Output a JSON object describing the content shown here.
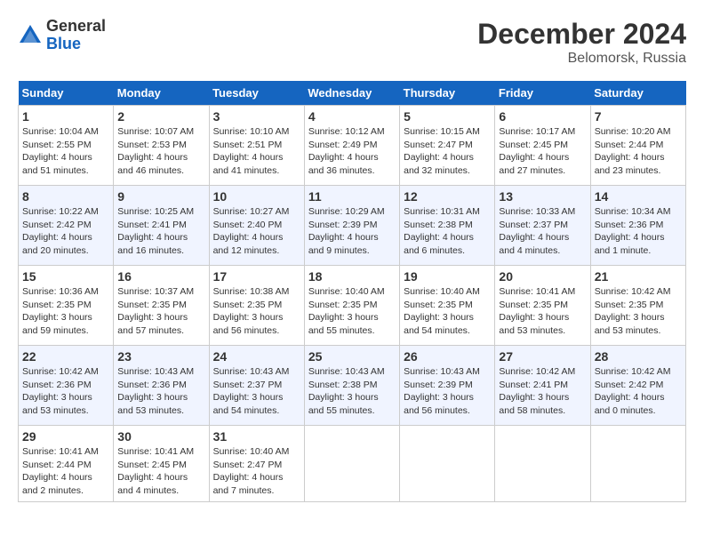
{
  "header": {
    "logo_general": "General",
    "logo_blue": "Blue",
    "month_title": "December 2024",
    "location": "Belomorsk, Russia"
  },
  "days_of_week": [
    "Sunday",
    "Monday",
    "Tuesday",
    "Wednesday",
    "Thursday",
    "Friday",
    "Saturday"
  ],
  "weeks": [
    [
      {
        "day": "1",
        "sunrise": "Sunrise: 10:04 AM",
        "sunset": "Sunset: 2:55 PM",
        "daylight": "Daylight: 4 hours and 51 minutes."
      },
      {
        "day": "2",
        "sunrise": "Sunrise: 10:07 AM",
        "sunset": "Sunset: 2:53 PM",
        "daylight": "Daylight: 4 hours and 46 minutes."
      },
      {
        "day": "3",
        "sunrise": "Sunrise: 10:10 AM",
        "sunset": "Sunset: 2:51 PM",
        "daylight": "Daylight: 4 hours and 41 minutes."
      },
      {
        "day": "4",
        "sunrise": "Sunrise: 10:12 AM",
        "sunset": "Sunset: 2:49 PM",
        "daylight": "Daylight: 4 hours and 36 minutes."
      },
      {
        "day": "5",
        "sunrise": "Sunrise: 10:15 AM",
        "sunset": "Sunset: 2:47 PM",
        "daylight": "Daylight: 4 hours and 32 minutes."
      },
      {
        "day": "6",
        "sunrise": "Sunrise: 10:17 AM",
        "sunset": "Sunset: 2:45 PM",
        "daylight": "Daylight: 4 hours and 27 minutes."
      },
      {
        "day": "7",
        "sunrise": "Sunrise: 10:20 AM",
        "sunset": "Sunset: 2:44 PM",
        "daylight": "Daylight: 4 hours and 23 minutes."
      }
    ],
    [
      {
        "day": "8",
        "sunrise": "Sunrise: 10:22 AM",
        "sunset": "Sunset: 2:42 PM",
        "daylight": "Daylight: 4 hours and 20 minutes."
      },
      {
        "day": "9",
        "sunrise": "Sunrise: 10:25 AM",
        "sunset": "Sunset: 2:41 PM",
        "daylight": "Daylight: 4 hours and 16 minutes."
      },
      {
        "day": "10",
        "sunrise": "Sunrise: 10:27 AM",
        "sunset": "Sunset: 2:40 PM",
        "daylight": "Daylight: 4 hours and 12 minutes."
      },
      {
        "day": "11",
        "sunrise": "Sunrise: 10:29 AM",
        "sunset": "Sunset: 2:39 PM",
        "daylight": "Daylight: 4 hours and 9 minutes."
      },
      {
        "day": "12",
        "sunrise": "Sunrise: 10:31 AM",
        "sunset": "Sunset: 2:38 PM",
        "daylight": "Daylight: 4 hours and 6 minutes."
      },
      {
        "day": "13",
        "sunrise": "Sunrise: 10:33 AM",
        "sunset": "Sunset: 2:37 PM",
        "daylight": "Daylight: 4 hours and 4 minutes."
      },
      {
        "day": "14",
        "sunrise": "Sunrise: 10:34 AM",
        "sunset": "Sunset: 2:36 PM",
        "daylight": "Daylight: 4 hours and 1 minute."
      }
    ],
    [
      {
        "day": "15",
        "sunrise": "Sunrise: 10:36 AM",
        "sunset": "Sunset: 2:35 PM",
        "daylight": "Daylight: 3 hours and 59 minutes."
      },
      {
        "day": "16",
        "sunrise": "Sunrise: 10:37 AM",
        "sunset": "Sunset: 2:35 PM",
        "daylight": "Daylight: 3 hours and 57 minutes."
      },
      {
        "day": "17",
        "sunrise": "Sunrise: 10:38 AM",
        "sunset": "Sunset: 2:35 PM",
        "daylight": "Daylight: 3 hours and 56 minutes."
      },
      {
        "day": "18",
        "sunrise": "Sunrise: 10:40 AM",
        "sunset": "Sunset: 2:35 PM",
        "daylight": "Daylight: 3 hours and 55 minutes."
      },
      {
        "day": "19",
        "sunrise": "Sunrise: 10:40 AM",
        "sunset": "Sunset: 2:35 PM",
        "daylight": "Daylight: 3 hours and 54 minutes."
      },
      {
        "day": "20",
        "sunrise": "Sunrise: 10:41 AM",
        "sunset": "Sunset: 2:35 PM",
        "daylight": "Daylight: 3 hours and 53 minutes."
      },
      {
        "day": "21",
        "sunrise": "Sunrise: 10:42 AM",
        "sunset": "Sunset: 2:35 PM",
        "daylight": "Daylight: 3 hours and 53 minutes."
      }
    ],
    [
      {
        "day": "22",
        "sunrise": "Sunrise: 10:42 AM",
        "sunset": "Sunset: 2:36 PM",
        "daylight": "Daylight: 3 hours and 53 minutes."
      },
      {
        "day": "23",
        "sunrise": "Sunrise: 10:43 AM",
        "sunset": "Sunset: 2:36 PM",
        "daylight": "Daylight: 3 hours and 53 minutes."
      },
      {
        "day": "24",
        "sunrise": "Sunrise: 10:43 AM",
        "sunset": "Sunset: 2:37 PM",
        "daylight": "Daylight: 3 hours and 54 minutes."
      },
      {
        "day": "25",
        "sunrise": "Sunrise: 10:43 AM",
        "sunset": "Sunset: 2:38 PM",
        "daylight": "Daylight: 3 hours and 55 minutes."
      },
      {
        "day": "26",
        "sunrise": "Sunrise: 10:43 AM",
        "sunset": "Sunset: 2:39 PM",
        "daylight": "Daylight: 3 hours and 56 minutes."
      },
      {
        "day": "27",
        "sunrise": "Sunrise: 10:42 AM",
        "sunset": "Sunset: 2:41 PM",
        "daylight": "Daylight: 3 hours and 58 minutes."
      },
      {
        "day": "28",
        "sunrise": "Sunrise: 10:42 AM",
        "sunset": "Sunset: 2:42 PM",
        "daylight": "Daylight: 4 hours and 0 minutes."
      }
    ],
    [
      {
        "day": "29",
        "sunrise": "Sunrise: 10:41 AM",
        "sunset": "Sunset: 2:44 PM",
        "daylight": "Daylight: 4 hours and 2 minutes."
      },
      {
        "day": "30",
        "sunrise": "Sunrise: 10:41 AM",
        "sunset": "Sunset: 2:45 PM",
        "daylight": "Daylight: 4 hours and 4 minutes."
      },
      {
        "day": "31",
        "sunrise": "Sunrise: 10:40 AM",
        "sunset": "Sunset: 2:47 PM",
        "daylight": "Daylight: 4 hours and 7 minutes."
      },
      null,
      null,
      null,
      null
    ]
  ]
}
